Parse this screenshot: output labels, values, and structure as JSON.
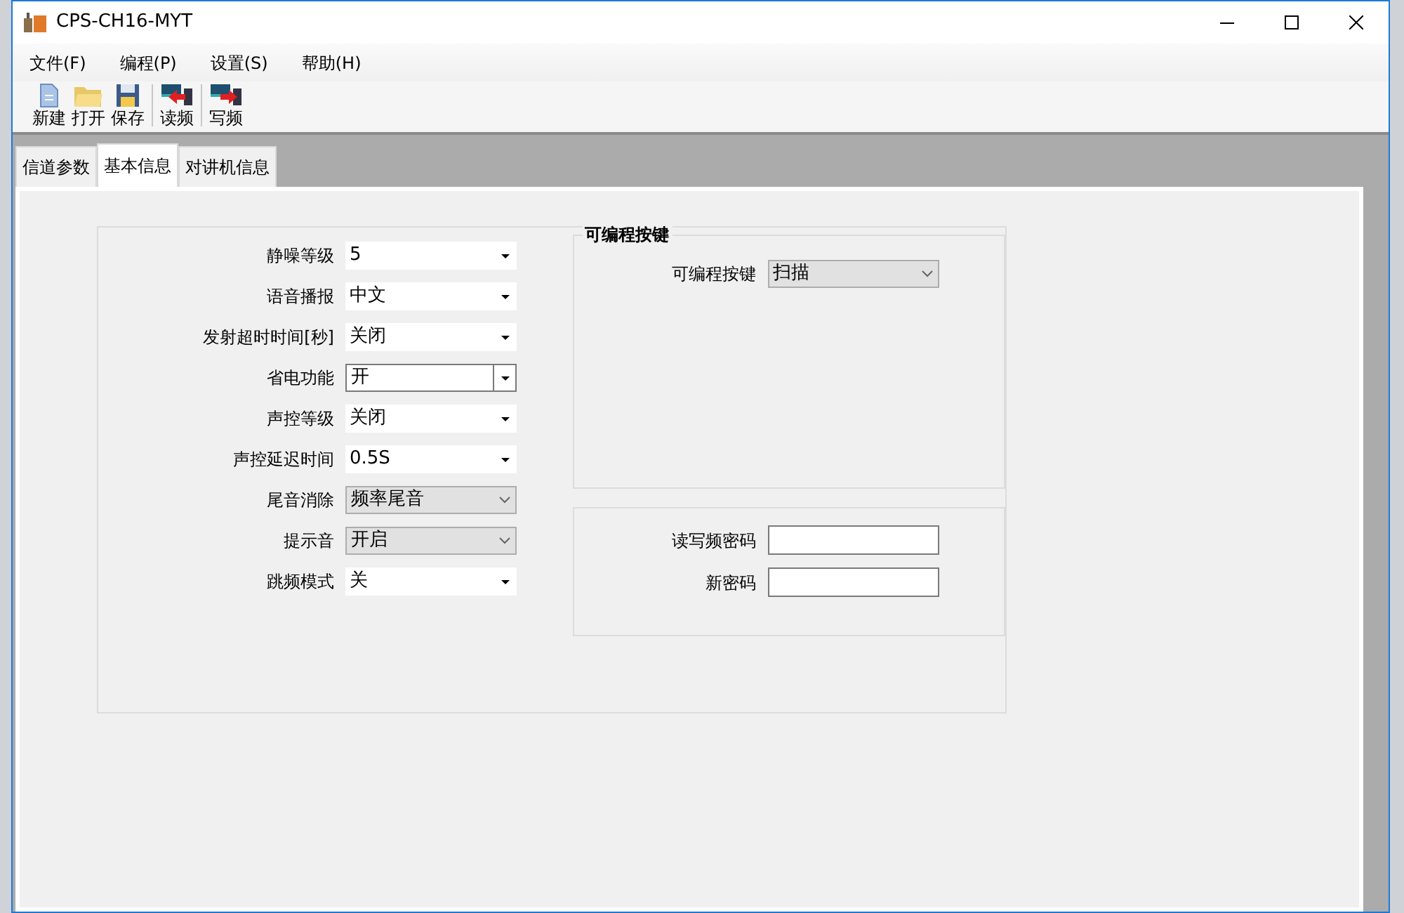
{
  "window": {
    "title": "CPS-CH16-MYT"
  },
  "menu": [
    "文件(F)",
    "编程(P)",
    "设置(S)",
    "帮助(H)"
  ],
  "toolbar": [
    {
      "label": "新建",
      "kind": "new"
    },
    {
      "label": "打开",
      "kind": "open"
    },
    {
      "label": "保存",
      "kind": "save"
    },
    {
      "label": "读频",
      "kind": "read"
    },
    {
      "label": "写频",
      "kind": "write"
    }
  ],
  "tabs": [
    {
      "label": "信道参数",
      "selected": false
    },
    {
      "label": "基本信息",
      "selected": true
    },
    {
      "label": "对讲机信息",
      "selected": false
    }
  ],
  "settings": [
    {
      "label": "静噪等级",
      "value": "5",
      "kind": "dropdown",
      "focused": false
    },
    {
      "label": "语音播报",
      "value": "中文",
      "kind": "dropdown",
      "focused": false
    },
    {
      "label": "发射超时时间[秒]",
      "value": "关闭",
      "kind": "dropdown",
      "focused": false
    },
    {
      "label": "省电功能",
      "value": "开",
      "kind": "dropdown",
      "focused": true
    },
    {
      "label": "声控等级",
      "value": "关闭",
      "kind": "dropdown",
      "focused": false
    },
    {
      "label": "声控延迟时间",
      "value": "0.5S",
      "kind": "dropdown",
      "focused": false
    },
    {
      "label": "尾音消除",
      "value": "频率尾音",
      "kind": "list",
      "focused": false
    },
    {
      "label": "提示音",
      "value": "开启",
      "kind": "list",
      "focused": false
    },
    {
      "label": "跳频模式",
      "value": "关",
      "kind": "dropdown",
      "focused": false
    }
  ],
  "programmable_keys": {
    "title": "可编程按键",
    "label": "可编程按键",
    "value": "扫描"
  },
  "password": {
    "fields": [
      {
        "label": "读写频密码"
      },
      {
        "label": "新密码"
      }
    ]
  }
}
